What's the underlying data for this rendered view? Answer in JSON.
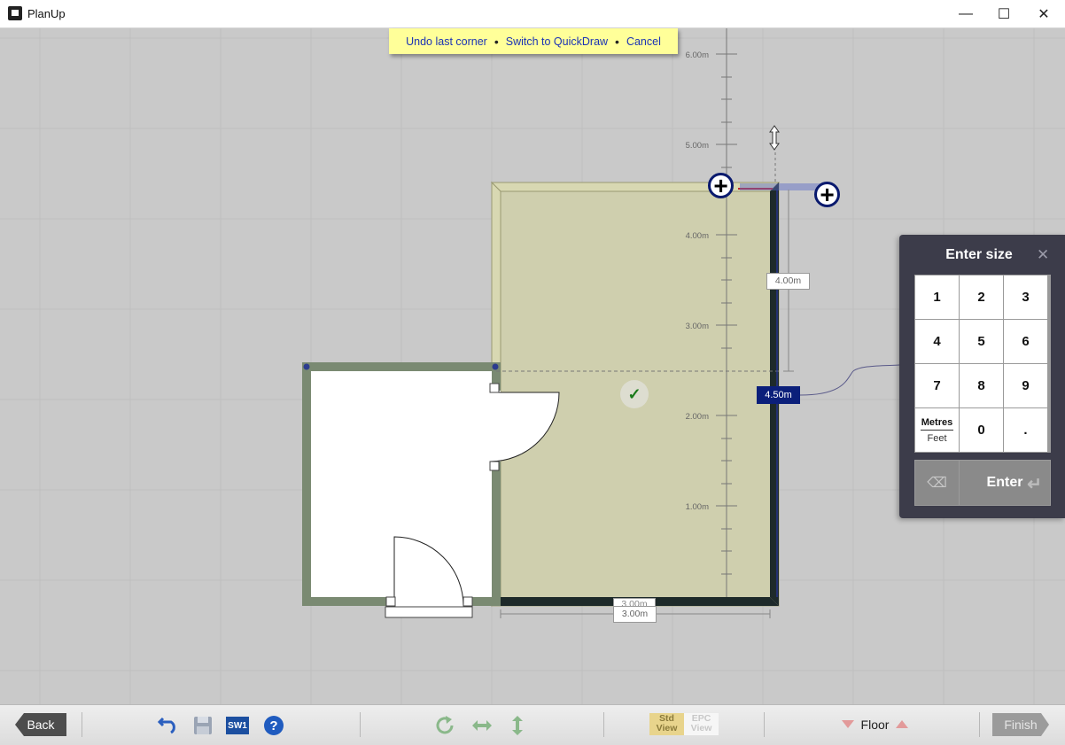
{
  "window": {
    "title": "PlanUp",
    "controls": {
      "minimize": "—",
      "maximize": "☐",
      "close": "✕"
    }
  },
  "hint_bar": {
    "undo": "Undo last corner",
    "quickdraw": "Switch to QuickDraw",
    "cancel": "Cancel",
    "separator": "•"
  },
  "ruler": {
    "labels": [
      "6.00m",
      "5.00m",
      "4.00m",
      "3.00m",
      "2.00m",
      "1.00m"
    ]
  },
  "dimensions": {
    "right_wall": "4.50m",
    "height_ghost": "4.00m",
    "bottom_overlap": "3.00m",
    "bottom": "3.00m"
  },
  "check_icon": "✓",
  "plus_icon": "+",
  "enter_size_panel": {
    "title": "Enter size",
    "close": "✕",
    "keys": [
      "1",
      "2",
      "3",
      "4",
      "5",
      "6",
      "7",
      "8",
      "9"
    ],
    "unit_primary": "Metres",
    "unit_secondary": "Feet",
    "zero": "0",
    "dot": ".",
    "backspace": "⌫",
    "enter": "Enter",
    "enter_icon": "↵"
  },
  "toolbar": {
    "back": "Back",
    "sw_label": "SW1",
    "help": "?",
    "std_view": [
      "Std",
      "View"
    ],
    "epc_view": [
      "EPC",
      "View"
    ],
    "floor": "Floor",
    "finish": "Finish",
    "icons": [
      "undo-icon",
      "save-icon",
      "sw1-icon",
      "help-icon",
      "rotate-icon",
      "flip-horizontal-icon",
      "flip-vertical-icon"
    ]
  },
  "colors": {
    "wall_existing": "#7a8a72",
    "wall_new": "#1e2a2a",
    "room_fill": "#cfcfae",
    "accent_blue": "#0b1f7a",
    "hint_bg": "#ffff99",
    "panel_bg": "#3c3c4a"
  }
}
